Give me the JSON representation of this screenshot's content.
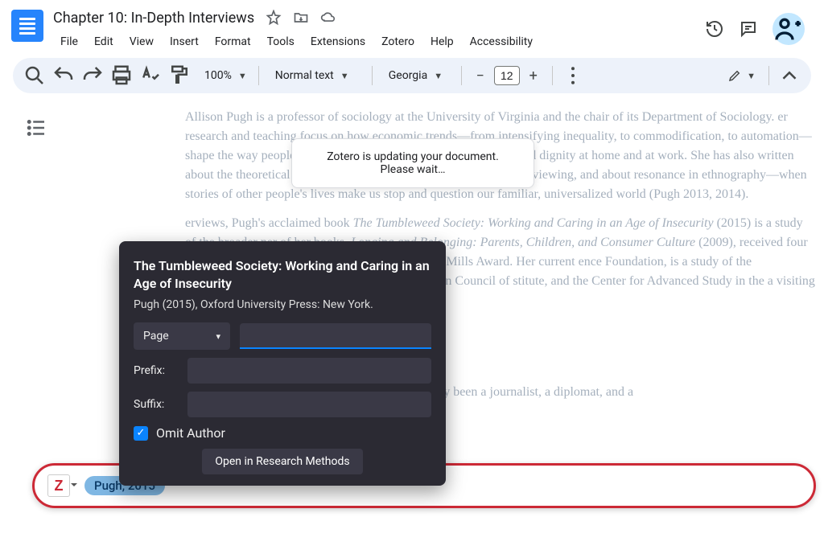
{
  "header": {
    "title": "Chapter 10: In-Depth Interviews",
    "menus": [
      "File",
      "Edit",
      "View",
      "Insert",
      "Format",
      "Tools",
      "Extensions",
      "Zotero",
      "Help",
      "Accessibility"
    ]
  },
  "toolbar": {
    "zoom": "100%",
    "style": "Normal text",
    "font": "Georgia",
    "size": "12"
  },
  "update_dialog": {
    "line1": "Zotero is updating your document.",
    "line2": "Please wait…"
  },
  "document": {
    "para1_a": "Allison Pugh is a professor of sociology at the University of Virginia and the chair of its Department of Sociology.                                                                           er research and teaching focus on how economic trends—from intensifying inequality, to commodification, to automation—shape the way people forge connections to each other, their care and dignity at home and at work. She has also written about the theoretical benefits and best practices of interpretive interviewing, and about resonance in ethnography—when stories of other people's lives make us stop and question our familiar, universalized world (Pugh 2013, 2014).",
    "para2_a": "                                                                                                     erviews, Pugh's acclaimed book ",
    "para2_b": "The Tumbleweed Society: Working and Caring in an Age of Insecurity",
    "para2_c": " (2015) is a study of the broader                                                                                                     ner of her books, ",
    "para2_d": "Longing and Belonging: Parents, Children, and Consumer Culture",
    "para2_e": " (2009), received four honors from the American                                                                                                                   nalist for the C. Wright Mills Award. Her current                                                                                                                   ence Foundation, is a study of the standardization                                                                                                                   e has been a fellow of the American Council of                                                                                                                           stitute, and the Center for Advanced Study in the                                                                                                                   a visiting scholar in Germany, France, and",
    "para3": "I found sociology relatively late, after I had already been a journalist, a diplomat, and a"
  },
  "zotero_popup": {
    "title": "The Tumbleweed Society: Working and Caring in an Age of Insecurity",
    "meta": "Pugh (2015), Oxford University Press: New York.",
    "locator_type": "Page",
    "prefix_label": "Prefix:",
    "suffix_label": "Suffix:",
    "omit_author_label": "Omit Author",
    "open_button": "Open in Research Methods"
  },
  "zotero_bar": {
    "pill": "Pugh, 2015"
  }
}
